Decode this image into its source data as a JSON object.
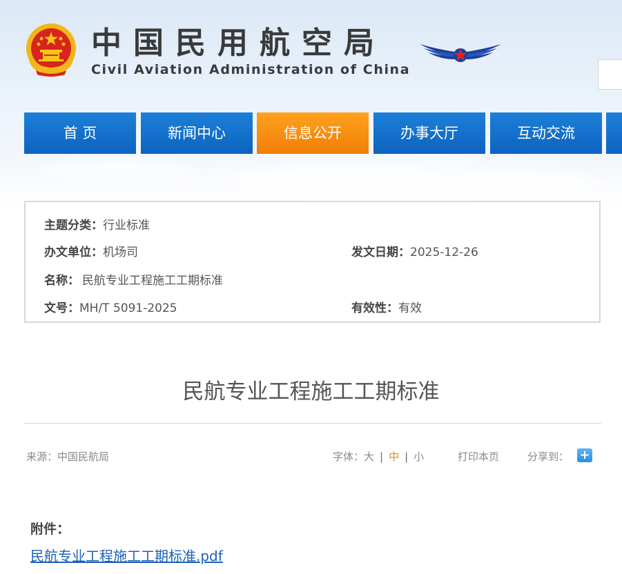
{
  "header": {
    "cn_title": "中国民用航空局",
    "en_title": "Civil Aviation Administration of China",
    "emblem_icon": "national-emblem-icon",
    "logo_icon": "caac-wing-logo-icon"
  },
  "nav": {
    "items": [
      {
        "label": "首 页"
      },
      {
        "label": "新闻中心"
      },
      {
        "label": "信息公开",
        "active": true
      },
      {
        "label": "办事大厅"
      },
      {
        "label": "互动交流"
      }
    ],
    "colors": {
      "normal": "#0f6ac6",
      "active": "#f5890f"
    }
  },
  "meta": {
    "topic_key": "主题分类：",
    "topic_val": "行业标准",
    "office_key": "办文单位：",
    "office_val": "机场司",
    "date_key": "发文日期：",
    "date_val": "2025-12-26",
    "name_key": "名称：",
    "name_val": "民航专业工程施工工期标准",
    "doc_key": "文号：",
    "doc_val": "MH/T 5091-2025",
    "valid_key": "有效性：",
    "valid_val": "有效"
  },
  "article": {
    "title": "民航专业工程施工工期标准"
  },
  "tools": {
    "source": "来源：中国民航局",
    "font_label": "字体：",
    "font_large": "大",
    "font_medium": "中",
    "font_small": "小",
    "print": "打印本页",
    "share": "分享到：",
    "share_icon": "plus-icon",
    "share_glyph": "+"
  },
  "attachment": {
    "label": "附件：",
    "file": "民航专业工程施工工期标准.pdf"
  }
}
